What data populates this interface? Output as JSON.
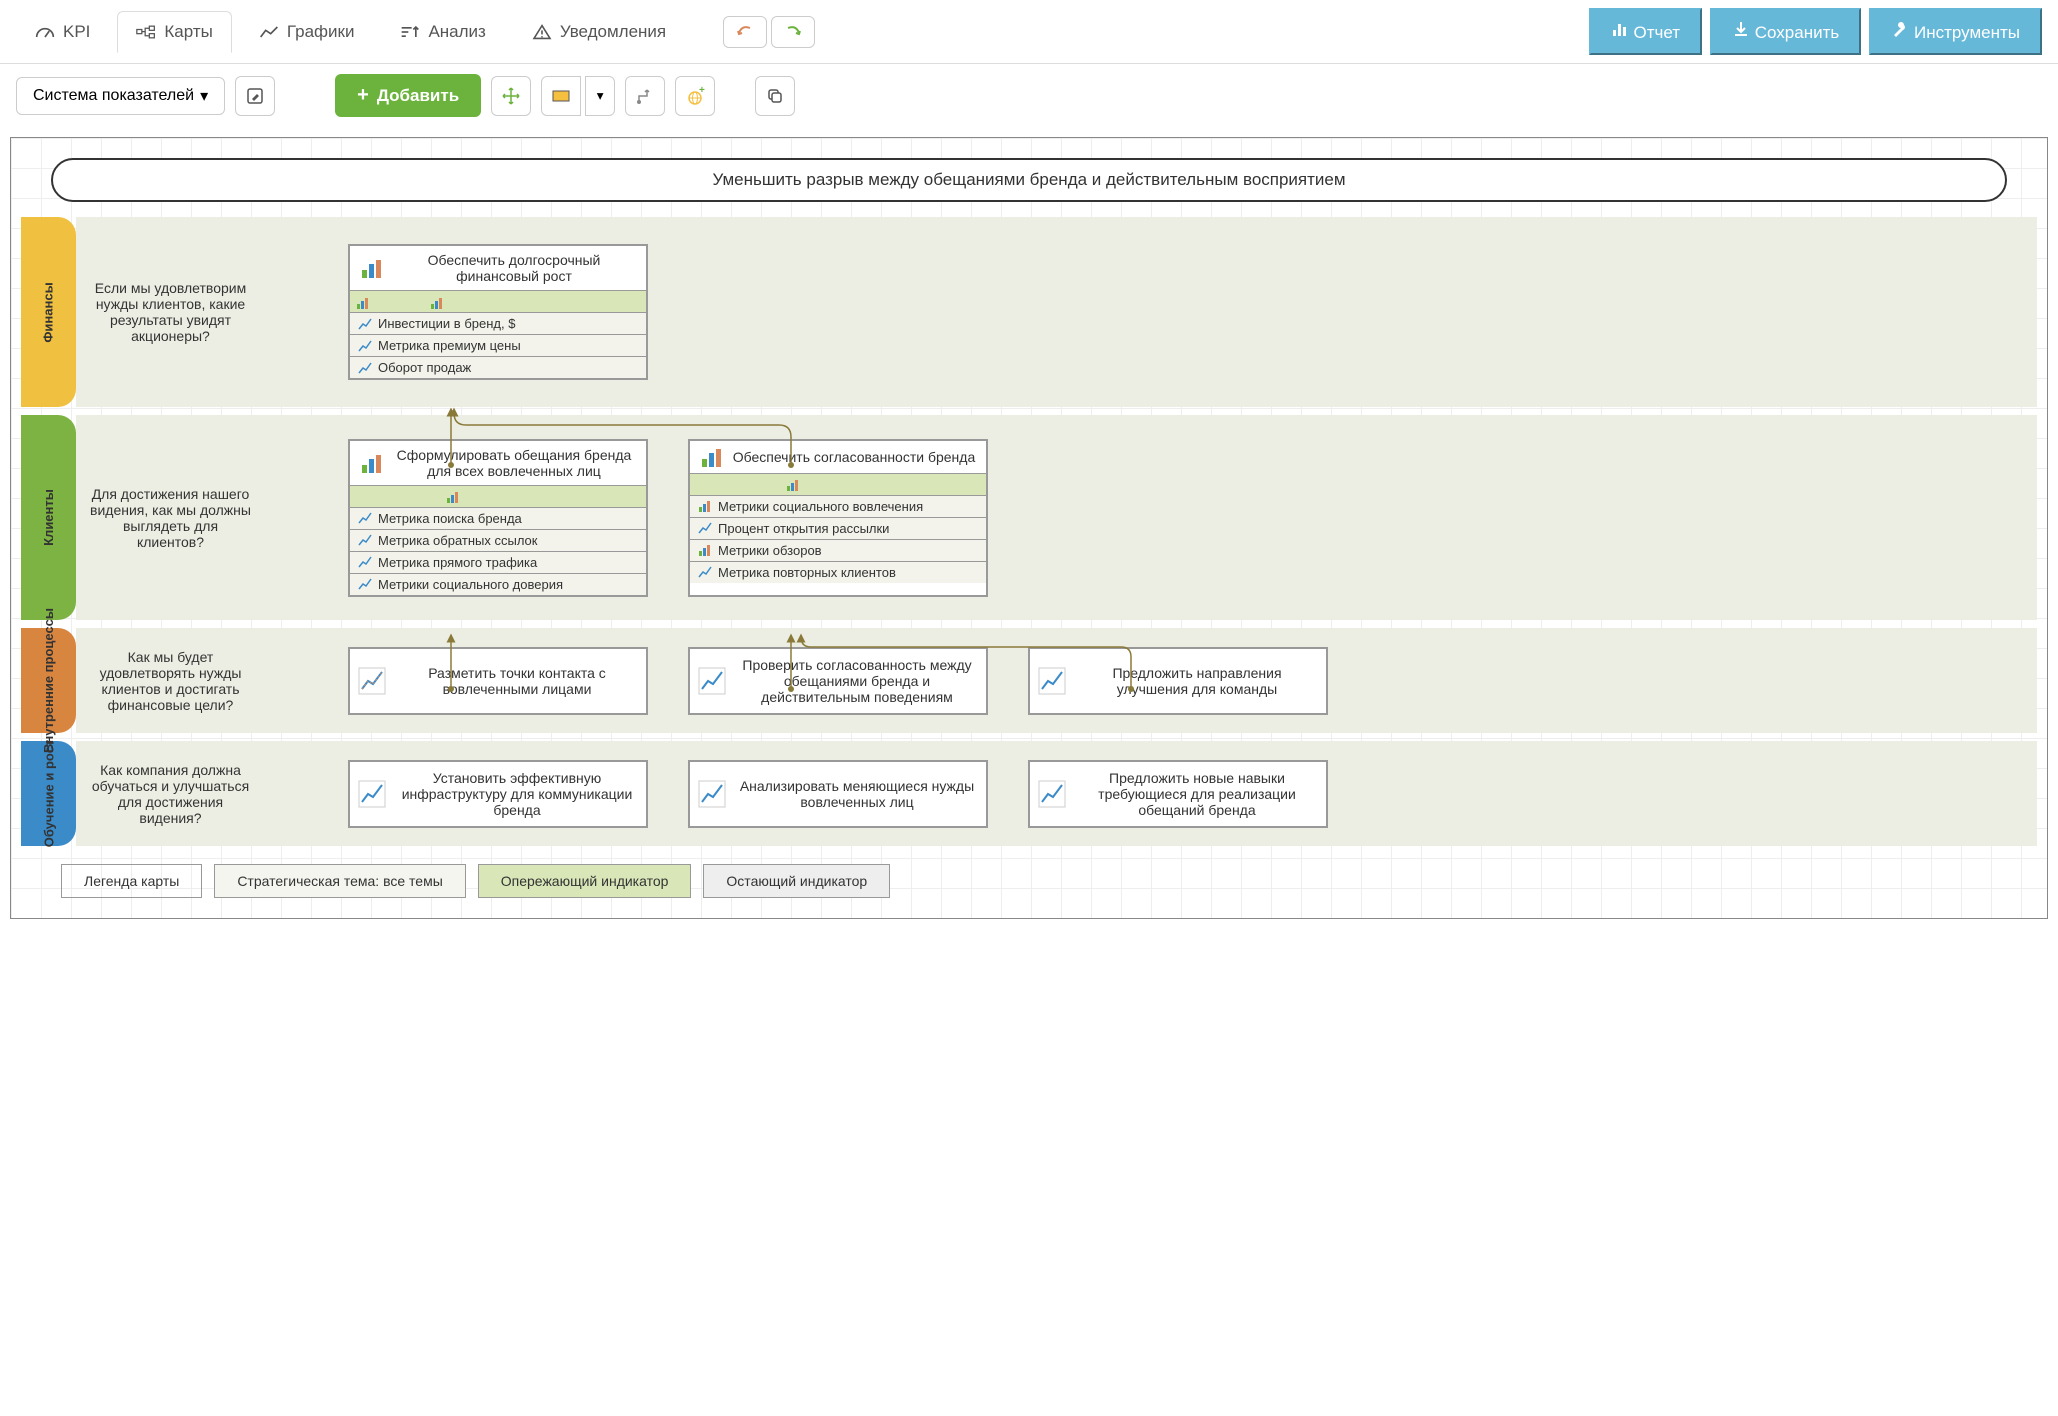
{
  "topTabs": {
    "kpi": "KPI",
    "maps": "Карты",
    "charts": "Графики",
    "analysis": "Анализ",
    "notifications": "Уведомления"
  },
  "topButtons": {
    "report": "Отчет",
    "save": "Сохранить",
    "tools": "Инструменты"
  },
  "secondToolbar": {
    "scorecard": "Система показателей",
    "add": "Добавить"
  },
  "title": "Уменьшить разрыв между обещаниями бренда и действительным восприятием",
  "perspectives": {
    "finance": {
      "label": "Финансы",
      "question": "Если мы удовлетворим нужды клиентов, какие результаты увидят акционеры?"
    },
    "clients": {
      "label": "Клиенты",
      "question": "Для достижения нашего видения, как мы должны выглядеть для клиентов?"
    },
    "internal": {
      "label": "Внутренние процессы",
      "question": "Как мы будет удовлетворять нужды клиентов и достигать финансовые цели?"
    },
    "learning": {
      "label": "Обучение и рост",
      "question": "Как компания должна обучаться и улучшаться для достижения видения?"
    }
  },
  "cards": {
    "finance1": {
      "title": "Обеспечить долгосрочный финансовый рост",
      "rows": [
        "Инвестиции в бренд, $",
        "Метрика премиум цены",
        "Оборот продаж"
      ]
    },
    "clients1": {
      "title": "Сформулировать обещания бренда для всех вовлеченных лиц",
      "rows": [
        "Метрика поиска бренда",
        "Метрика обратных ссылок",
        "Метрика прямого трафика",
        "Метрики социального доверия"
      ]
    },
    "clients2": {
      "title": "Обеспечить согласованности бренда",
      "rows": [
        "Метрики социального вовлечения",
        "Процент открытия рассылки",
        "Метрики обзоров",
        "Метрика повторных клиентов"
      ]
    },
    "internal1": "Разметить точки контакта с вовлеченными лицами",
    "internal2": "Проверить согласованность между обещаниями бренда и действительным поведениям",
    "internal3": "Предложить направления улучшения для команды",
    "learning1": "Установить эффективную инфраструктуру для коммуникации бренда",
    "learning2": "Анализировать меняющиеся нужды вовлеченных лиц",
    "learning3": "Предложить новые навыки требующиеся для реализации обещаний бренда"
  },
  "legend": {
    "legend": "Легенда карты",
    "theme": "Стратегическая тема: все темы",
    "leading": "Опережающий индикатор",
    "lagging": "Остающий индикатор"
  }
}
